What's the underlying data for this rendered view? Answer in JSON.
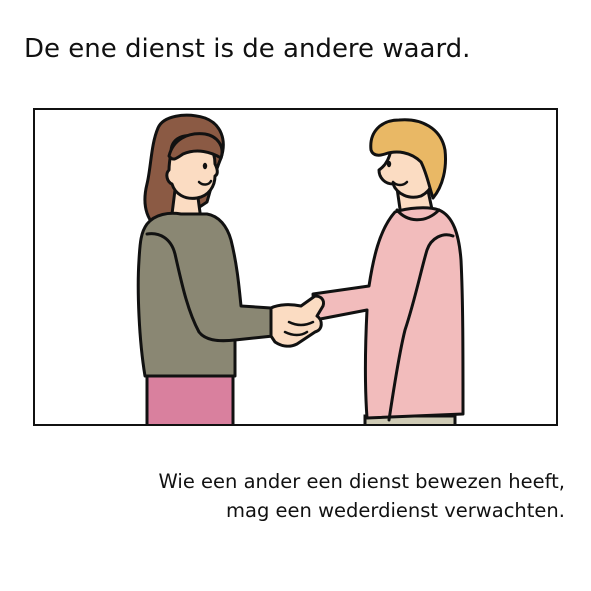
{
  "title": "De ene dienst is de andere waard.",
  "illustration": {
    "icon": "handshake-illustration-icon",
    "colors": {
      "woman_hair": "#8b5a44",
      "woman_top": "#8a8773",
      "woman_skirt": "#d9809e",
      "man_hair": "#e9b865",
      "man_top": "#f2bcbc",
      "man_trousers": "#cfcbb5",
      "skin": "#fbdcc2",
      "outline": "#111111"
    }
  },
  "caption": {
    "line1": "Wie een ander een dienst bewezen heeft,",
    "line2": "mag een wederdienst verwachten."
  }
}
